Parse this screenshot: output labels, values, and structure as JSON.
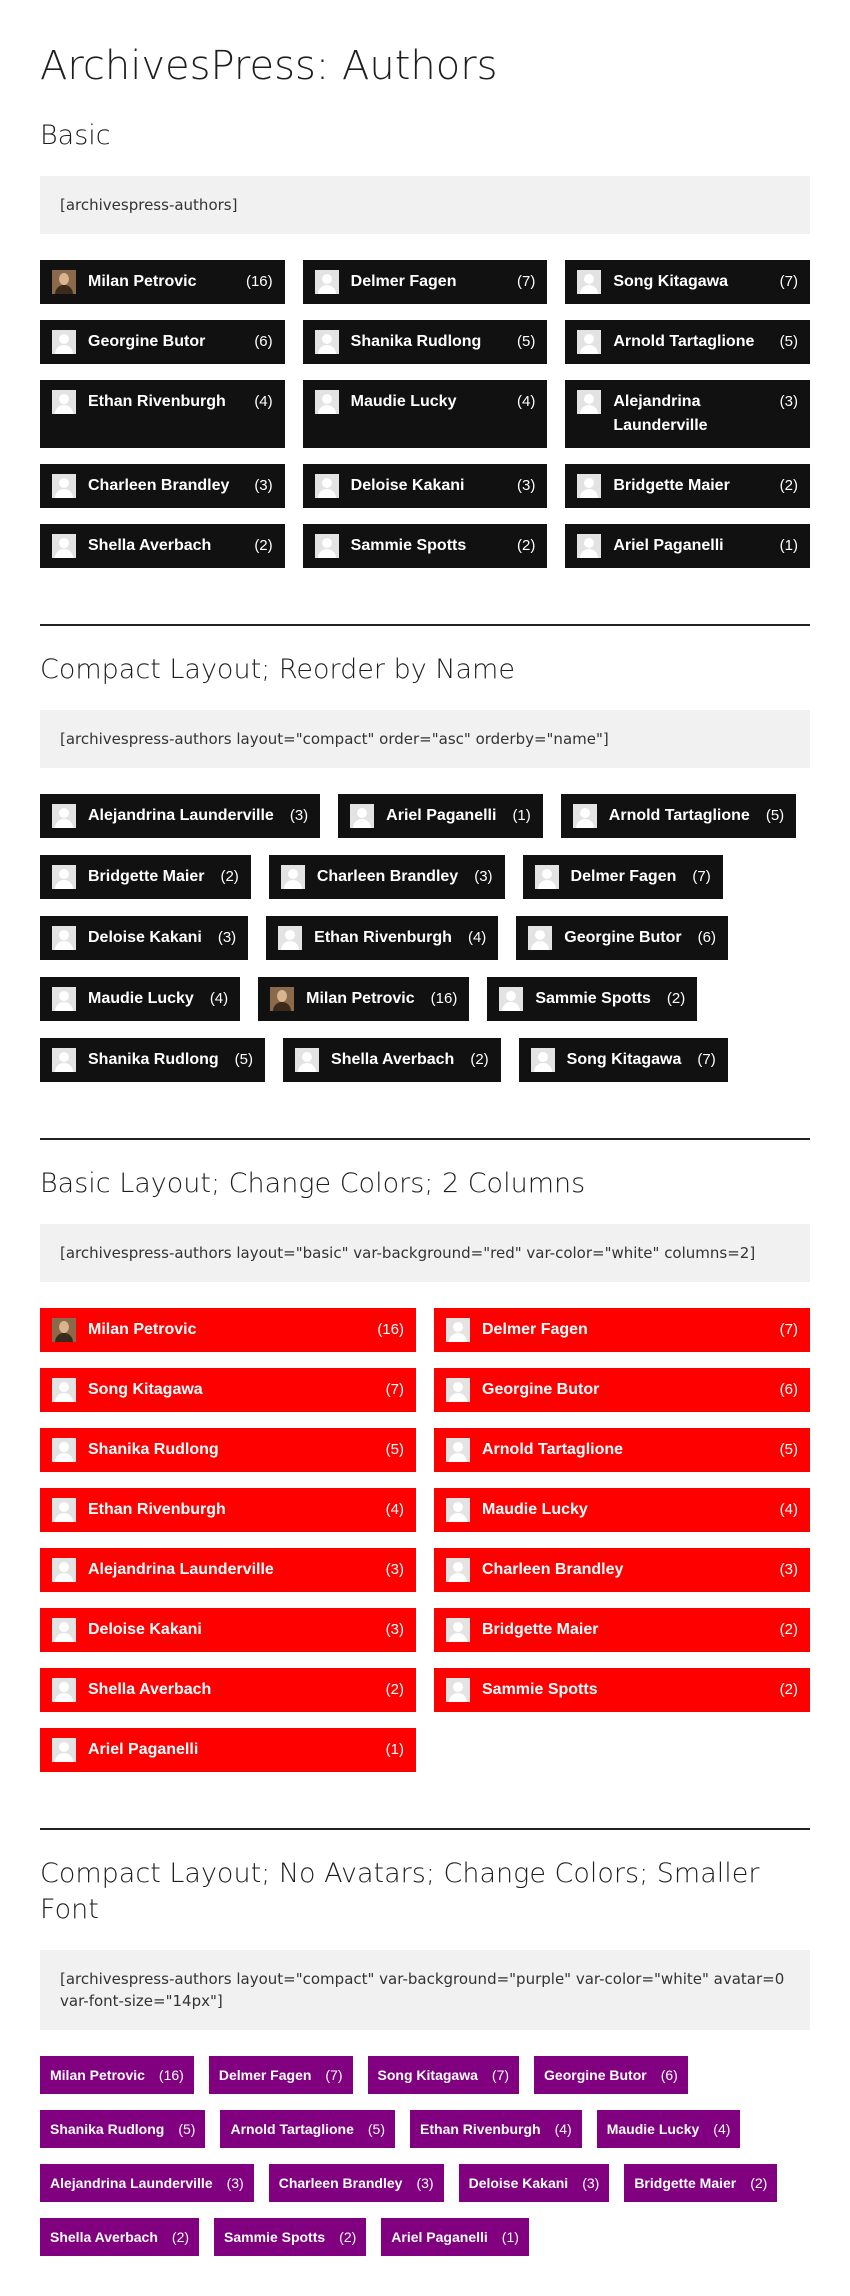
{
  "page_title": "ArchivesPress: Authors",
  "sections": [
    {
      "title": "Basic",
      "shortcode": "[archivespress-authors]",
      "authors": [
        {
          "name": "Milan Petrovic",
          "count": "(16)",
          "avatar": "photo"
        },
        {
          "name": "Delmer Fagen",
          "count": "(7)",
          "avatar": "default"
        },
        {
          "name": "Song Kitagawa",
          "count": "(7)",
          "avatar": "default"
        },
        {
          "name": "Georgine Butor",
          "count": "(6)",
          "avatar": "default"
        },
        {
          "name": "Shanika Rudlong",
          "count": "(5)",
          "avatar": "default"
        },
        {
          "name": "Arnold Tartaglione",
          "count": "(5)",
          "avatar": "default"
        },
        {
          "name": "Ethan Rivenburgh",
          "count": "(4)",
          "avatar": "default"
        },
        {
          "name": "Maudie Lucky",
          "count": "(4)",
          "avatar": "default"
        },
        {
          "name": "Alejandrina Launderville",
          "count": "(3)",
          "avatar": "default"
        },
        {
          "name": "Charleen Brandley",
          "count": "(3)",
          "avatar": "default"
        },
        {
          "name": "Deloise Kakani",
          "count": "(3)",
          "avatar": "default"
        },
        {
          "name": "Bridgette Maier",
          "count": "(2)",
          "avatar": "default"
        },
        {
          "name": "Shella Averbach",
          "count": "(2)",
          "avatar": "default"
        },
        {
          "name": "Sammie Spotts",
          "count": "(2)",
          "avatar": "default"
        },
        {
          "name": "Ariel Paganelli",
          "count": "(1)",
          "avatar": "default"
        }
      ]
    },
    {
      "title": "Compact Layout; Reorder by Name",
      "shortcode": "[archivespress-authors layout=\"compact\" order=\"asc\" orderby=\"name\"]",
      "authors": [
        {
          "name": "Alejandrina Launderville",
          "count": "(3)",
          "avatar": "default"
        },
        {
          "name": "Ariel Paganelli",
          "count": "(1)",
          "avatar": "default"
        },
        {
          "name": "Arnold Tartaglione",
          "count": "(5)",
          "avatar": "default"
        },
        {
          "name": "Bridgette Maier",
          "count": "(2)",
          "avatar": "default"
        },
        {
          "name": "Charleen Brandley",
          "count": "(3)",
          "avatar": "default"
        },
        {
          "name": "Delmer Fagen",
          "count": "(7)",
          "avatar": "default"
        },
        {
          "name": "Deloise Kakani",
          "count": "(3)",
          "avatar": "default"
        },
        {
          "name": "Ethan Rivenburgh",
          "count": "(4)",
          "avatar": "default"
        },
        {
          "name": "Georgine Butor",
          "count": "(6)",
          "avatar": "default"
        },
        {
          "name": "Maudie Lucky",
          "count": "(4)",
          "avatar": "default"
        },
        {
          "name": "Milan Petrovic",
          "count": "(16)",
          "avatar": "photo"
        },
        {
          "name": "Sammie Spotts",
          "count": "(2)",
          "avatar": "default"
        },
        {
          "name": "Shanika Rudlong",
          "count": "(5)",
          "avatar": "default"
        },
        {
          "name": "Shella Averbach",
          "count": "(2)",
          "avatar": "default"
        },
        {
          "name": "Song Kitagawa",
          "count": "(7)",
          "avatar": "default"
        }
      ]
    },
    {
      "title": "Basic Layout; Change Colors; 2 Columns",
      "shortcode": "[archivespress-authors layout=\"basic\" var-background=\"red\" var-color=\"white\" columns=2]",
      "authors": [
        {
          "name": "Milan Petrovic",
          "count": "(16)",
          "avatar": "photo"
        },
        {
          "name": "Delmer Fagen",
          "count": "(7)",
          "avatar": "default"
        },
        {
          "name": "Song Kitagawa",
          "count": "(7)",
          "avatar": "default"
        },
        {
          "name": "Georgine Butor",
          "count": "(6)",
          "avatar": "default"
        },
        {
          "name": "Shanika Rudlong",
          "count": "(5)",
          "avatar": "default"
        },
        {
          "name": "Arnold Tartaglione",
          "count": "(5)",
          "avatar": "default"
        },
        {
          "name": "Ethan Rivenburgh",
          "count": "(4)",
          "avatar": "default"
        },
        {
          "name": "Maudie Lucky",
          "count": "(4)",
          "avatar": "default"
        },
        {
          "name": "Alejandrina Launderville",
          "count": "(3)",
          "avatar": "default"
        },
        {
          "name": "Charleen Brandley",
          "count": "(3)",
          "avatar": "default"
        },
        {
          "name": "Deloise Kakani",
          "count": "(3)",
          "avatar": "default"
        },
        {
          "name": "Bridgette Maier",
          "count": "(2)",
          "avatar": "default"
        },
        {
          "name": "Shella Averbach",
          "count": "(2)",
          "avatar": "default"
        },
        {
          "name": "Sammie Spotts",
          "count": "(2)",
          "avatar": "default"
        },
        {
          "name": "Ariel Paganelli",
          "count": "(1)",
          "avatar": "default"
        }
      ]
    },
    {
      "title": "Compact Layout; No Avatars; Change Colors; Smaller Font",
      "shortcode": "[archivespress-authors layout=\"compact\" var-background=\"purple\" var-color=\"white\" avatar=0 var-font-size=\"14px\"]",
      "authors": [
        {
          "name": "Milan Petrovic",
          "count": "(16)"
        },
        {
          "name": "Delmer Fagen",
          "count": "(7)"
        },
        {
          "name": "Song Kitagawa",
          "count": "(7)"
        },
        {
          "name": "Georgine Butor",
          "count": "(6)"
        },
        {
          "name": "Shanika Rudlong",
          "count": "(5)"
        },
        {
          "name": "Arnold Tartaglione",
          "count": "(5)"
        },
        {
          "name": "Ethan Rivenburgh",
          "count": "(4)"
        },
        {
          "name": "Maudie Lucky",
          "count": "(4)"
        },
        {
          "name": "Alejandrina Launderville",
          "count": "(3)"
        },
        {
          "name": "Charleen Brandley",
          "count": "(3)"
        },
        {
          "name": "Deloise Kakani",
          "count": "(3)"
        },
        {
          "name": "Bridgette Maier",
          "count": "(2)"
        },
        {
          "name": "Shella Averbach",
          "count": "(2)"
        },
        {
          "name": "Sammie Spotts",
          "count": "(2)"
        },
        {
          "name": "Ariel Paganelli",
          "count": "(1)"
        }
      ]
    }
  ],
  "colors": {
    "basic_background": "#111111",
    "red_background": "#ff0000",
    "purple_background": "#800080",
    "text": "#ffffff",
    "code_background": "#f1f1f1"
  }
}
